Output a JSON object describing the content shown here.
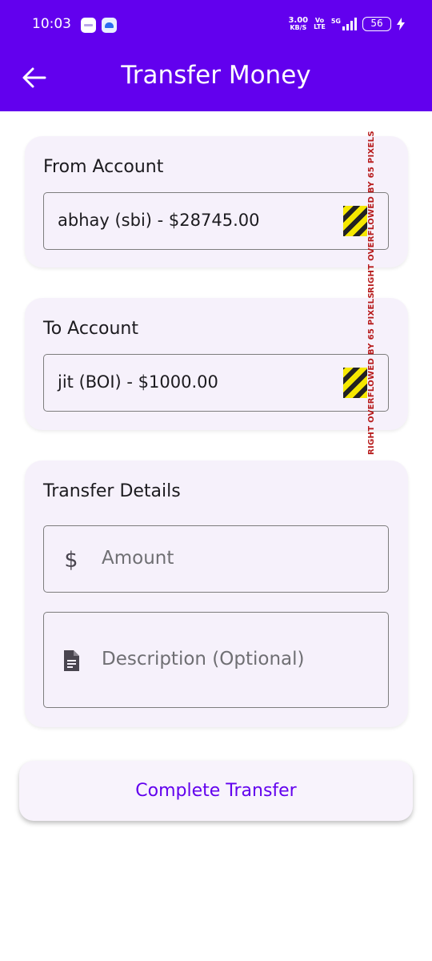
{
  "status_bar": {
    "time": "10:03",
    "net_speed_value": "3.00",
    "net_speed_unit": "KB/S",
    "volte_top": "Vo",
    "volte_bottom": "LTE",
    "network": "5G",
    "battery": "56"
  },
  "app_bar": {
    "title": "Transfer Money",
    "back_icon": "arrow-left-icon",
    "color": "#6200ee"
  },
  "from_account": {
    "title": "From Account",
    "selected": "abhay (sbi) - $28745.00",
    "overflow_warning": "RIGHT OVERFLOWED BY 65 PIXELS"
  },
  "to_account": {
    "title": "To Account",
    "selected": "jit (BOI) - $1000.00",
    "overflow_warning": "RIGHT OVERFLOWED BY 65 PIXELS"
  },
  "transfer_details": {
    "title": "Transfer Details",
    "amount_placeholder": "Amount",
    "amount_icon": "dollar-icon",
    "description_placeholder": "Description (Optional)",
    "description_icon": "document-icon"
  },
  "actions": {
    "complete_label": "Complete Transfer"
  }
}
